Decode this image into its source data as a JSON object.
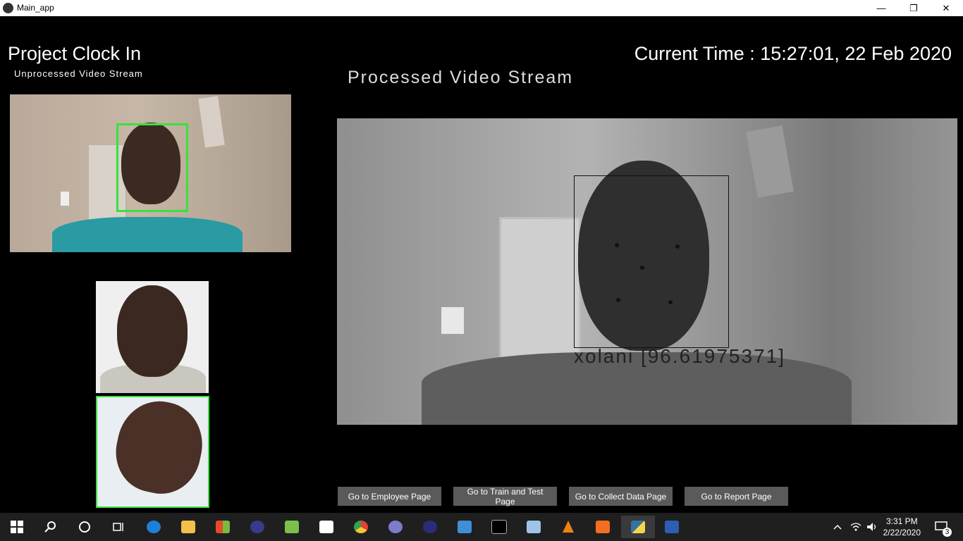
{
  "window": {
    "title": "Main_app",
    "minimize": "—",
    "restore": "❐",
    "close": "✕"
  },
  "header": {
    "app_title": "Project Clock In",
    "clock": "Current Time : 15:27:01, 22 Feb 2020"
  },
  "streams": {
    "unprocessed_label": "Unprocessed Video Stream",
    "processed_label": "Processed Video Stream",
    "recognition_label": "xolani [96.61975371]"
  },
  "nav": {
    "employee": "Go to Employee Page",
    "train_test": "Go to Train and Test Page",
    "collect_data": "Go to Collect Data Page",
    "report": "Go to Report Page"
  },
  "taskbar": {
    "time": "3:31 PM",
    "date": "2/22/2020",
    "notifications": "3",
    "icons": [
      "windows-start-icon",
      "search-icon",
      "cortana-icon",
      "task-view-icon",
      "edge-icon",
      "file-explorer-icon",
      "store-icon",
      "eclipse-icon",
      "notepad-icon",
      "mail-icon",
      "chrome-icon",
      "bittorrent-icon",
      "eclipse-ide-icon",
      "control-panel-icon",
      "terminal-icon",
      "virtualbox-icon",
      "vlc-icon",
      "xampp-icon",
      "python-icon",
      "word-icon"
    ]
  },
  "colors": {
    "accent_green": "#39e23b",
    "background": "#000000",
    "button_bg": "#5a5a5a"
  }
}
